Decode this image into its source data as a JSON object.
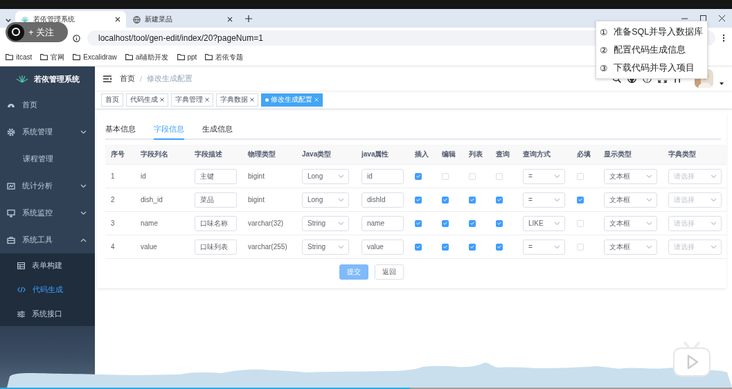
{
  "browser": {
    "tabs": [
      {
        "title": "若依管理系统",
        "selected": true
      },
      {
        "title": "新建菜品",
        "selected": false
      }
    ],
    "url": "localhost/tool/gen-edit/index/20?pageNum=1",
    "bookmarks": [
      "itcast",
      "官网",
      "Excalidraw",
      "ai辅助开发",
      "ppt",
      "若依专题"
    ]
  },
  "follow_button": "+ 关注",
  "steps_popup": [
    {
      "marker": "①",
      "text": "准备SQL并导入数据库"
    },
    {
      "marker": "②",
      "text": "配置代码生成信息"
    },
    {
      "marker": "③",
      "text": "下载代码并导入项目"
    }
  ],
  "sidebar": {
    "title": "若依管理系统",
    "items": [
      {
        "label": "首页",
        "selected": false
      },
      {
        "label": "系统管理",
        "selected": false,
        "expanded": false
      },
      {
        "label": "课程管理",
        "selected": false
      },
      {
        "label": "统计分析",
        "selected": false,
        "expanded": false
      },
      {
        "label": "系统监控",
        "selected": false,
        "expanded": false
      },
      {
        "label": "系统工具",
        "selected": false,
        "expanded": true,
        "children": [
          {
            "label": "表单构建",
            "selected": false
          },
          {
            "label": "代码生成",
            "selected": true
          },
          {
            "label": "系统接口",
            "selected": false
          }
        ]
      }
    ]
  },
  "breadcrumb": [
    "首页",
    "修改生成配置"
  ],
  "breadcrumb_separator": "/",
  "tags": [
    {
      "label": "首页",
      "selected": false,
      "closable": false
    },
    {
      "label": "代码生成",
      "selected": false,
      "closable": true
    },
    {
      "label": "字典管理",
      "selected": false,
      "closable": true
    },
    {
      "label": "字典数据",
      "selected": false,
      "closable": true
    },
    {
      "label": "修改生成配置",
      "selected": true,
      "closable": true
    }
  ],
  "tabs": [
    {
      "label": "基本信息",
      "selected": false
    },
    {
      "label": "字段信息",
      "selected": true
    },
    {
      "label": "生成信息",
      "selected": false
    }
  ],
  "table": {
    "columns": [
      "序号",
      "字段列名",
      "字段描述",
      "物理类型",
      "Java类型",
      "java属性",
      "插入",
      "编辑",
      "列表",
      "查询",
      "查询方式",
      "必填",
      "显示类型",
      "字典类型"
    ],
    "rows": [
      {
        "index": "1",
        "column_name": "id",
        "description": "主键",
        "physical_type": "bigint",
        "java_type": "Long",
        "java_field": "id",
        "insert": true,
        "edit": false,
        "list": false,
        "query": false,
        "query_type": "=",
        "required": false,
        "display_type": "文本框",
        "dict_placeholder": "请选择"
      },
      {
        "index": "2",
        "column_name": "dish_id",
        "description": "菜品",
        "physical_type": "bigint",
        "java_type": "Long",
        "java_field": "dishId",
        "insert": true,
        "edit": true,
        "list": true,
        "query": true,
        "query_type": "=",
        "required": true,
        "display_type": "文本框",
        "dict_placeholder": "请选择"
      },
      {
        "index": "3",
        "column_name": "name",
        "description": "口味名称",
        "physical_type": "varchar(32)",
        "java_type": "String",
        "java_field": "name",
        "insert": true,
        "edit": true,
        "list": true,
        "query": true,
        "query_type": "LIKE",
        "required": false,
        "display_type": "文本框",
        "dict_placeholder": "请选择"
      },
      {
        "index": "4",
        "column_name": "value",
        "description": "口味列表",
        "physical_type": "varchar(255)",
        "java_type": "String",
        "java_field": "value",
        "insert": true,
        "edit": true,
        "list": true,
        "query": true,
        "query_type": "=",
        "required": false,
        "display_type": "文本框",
        "dict_placeholder": "请选择"
      }
    ]
  },
  "buttons": [
    {
      "label": "提交",
      "kind": "primary"
    },
    {
      "label": "返回",
      "kind": "default"
    }
  ],
  "video_progress": {
    "level": 0.56
  }
}
